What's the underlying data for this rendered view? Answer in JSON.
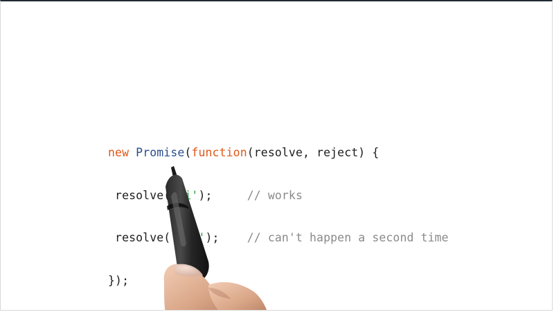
{
  "code": {
    "line1": {
      "kw_new": "new",
      "class_name": "Promise",
      "paren_open": "(",
      "kw_function": "function",
      "params": "(resolve, reject) {"
    },
    "line2": {
      "call": "resolve(",
      "arg": "'hi'",
      "end": ");",
      "comment": "// works"
    },
    "line3": {
      "call": "resolve(",
      "arg": "'bye'",
      "end": ");",
      "comment": "// can't happen a second time"
    },
    "line4": {
      "text": "});"
    }
  },
  "colors": {
    "keyword": "#e0581a",
    "class": "#2a4c8e",
    "string": "#1aa33a",
    "comment": "#8a8a8a"
  },
  "icons": {
    "pen": "stylus-pen-icon",
    "hand": "hand-holding-pen"
  }
}
